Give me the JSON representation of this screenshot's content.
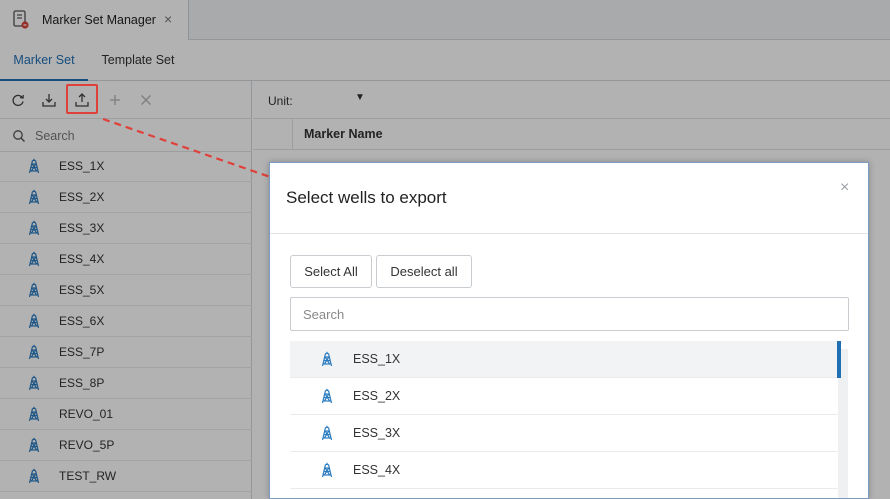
{
  "doc_tab": {
    "title": "Marker Set Manager",
    "close": "×"
  },
  "sub_tabs": [
    {
      "label": "Marker Set",
      "active": true
    },
    {
      "label": "Template Set",
      "active": false
    }
  ],
  "left_panel": {
    "toolbar": {
      "buttons": [
        {
          "icon": "refresh-icon"
        },
        {
          "icon": "import-icon"
        },
        {
          "icon": "export-icon",
          "highlighted": true
        },
        {
          "icon": "add-icon",
          "disabled": true
        },
        {
          "icon": "delete-icon",
          "disabled": true
        }
      ]
    },
    "search_placeholder": "Search",
    "wells": [
      "ESS_1X",
      "ESS_2X",
      "ESS_3X",
      "ESS_4X",
      "ESS_5X",
      "ESS_6X",
      "ESS_7P",
      "ESS_8P",
      "REVO_01",
      "REVO_5P",
      "TEST_RW"
    ]
  },
  "main": {
    "unit_label": "Unit:",
    "unit_caret": "▼",
    "column_header": "Marker Name"
  },
  "modal": {
    "title": "Select wells to export",
    "close": "×",
    "select_all": "Select All",
    "deselect_all": "Deselect all",
    "search_placeholder": "Search",
    "wells": [
      "ESS_1X",
      "ESS_2X",
      "ESS_3X",
      "ESS_4X"
    ],
    "selected_index": 0
  },
  "colors": {
    "accent": "#1f6fb5",
    "highlight": "#e0403a",
    "well_icon": "#2a7bc0"
  }
}
